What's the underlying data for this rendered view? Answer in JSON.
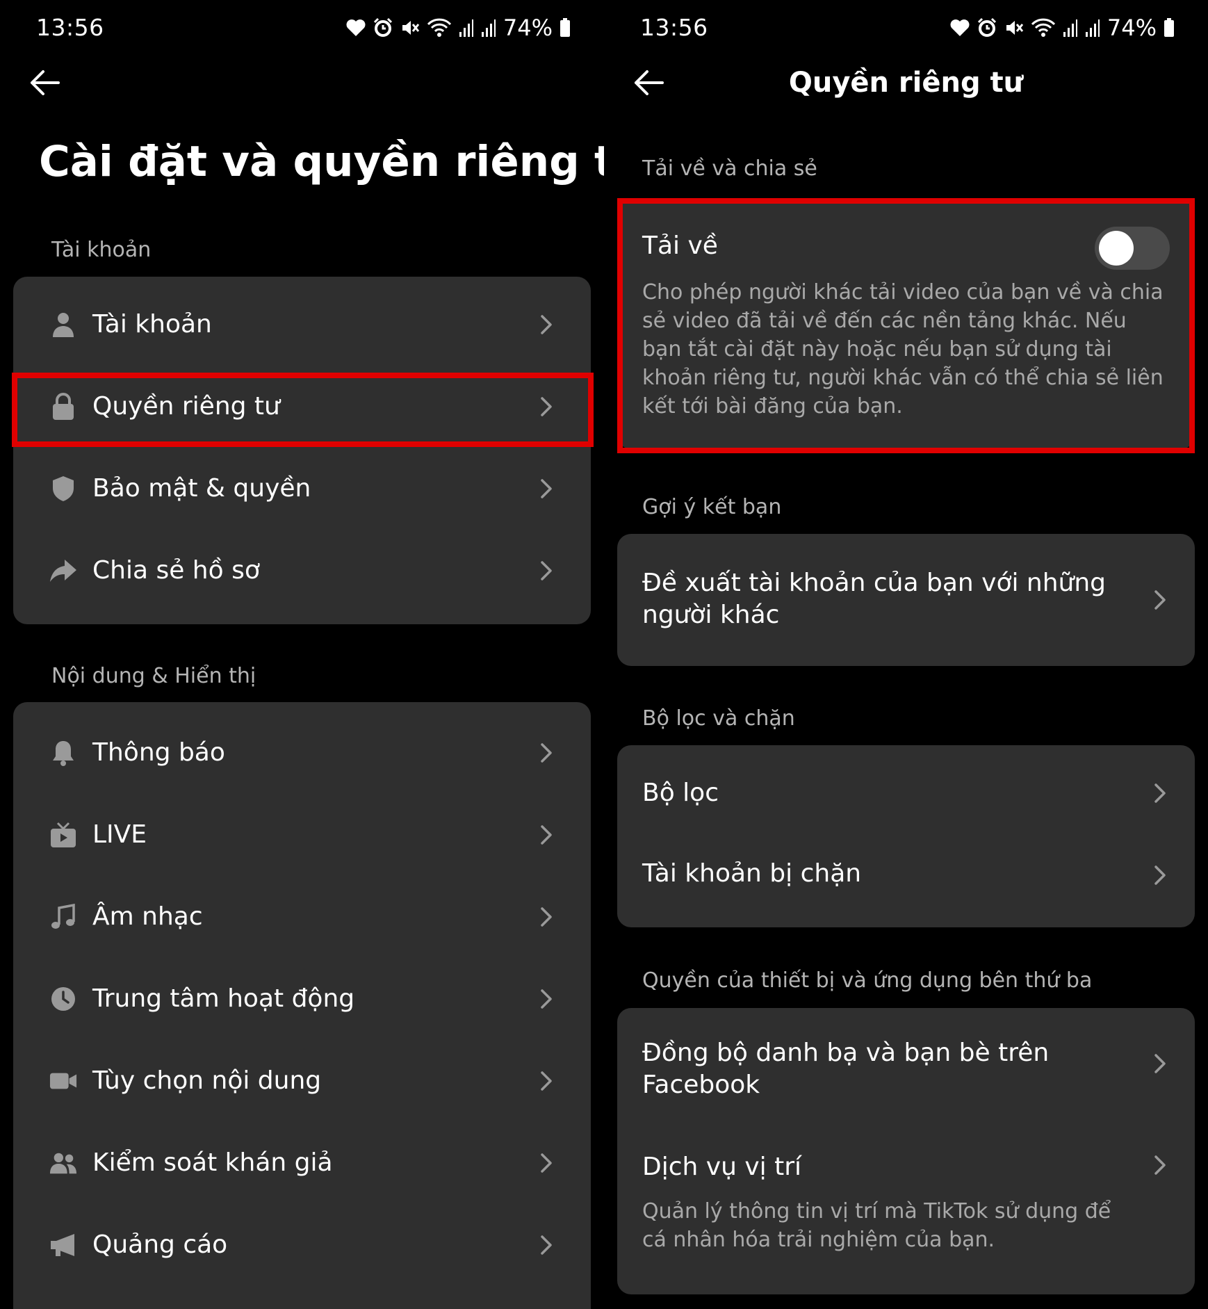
{
  "status_bar": {
    "time": "13:56",
    "battery": "74%",
    "icons": [
      "heart-icon",
      "alarm-icon",
      "mute-icon",
      "wifi-icon",
      "signal-icon",
      "signal-icon",
      "battery-icon"
    ]
  },
  "left": {
    "title": "Cài đặt và quyền riêng tư",
    "section_account": "Tài khoản",
    "account_items": [
      {
        "label": "Tài khoản",
        "icon": "person-icon"
      },
      {
        "label": "Quyền riêng tư",
        "icon": "lock-icon"
      },
      {
        "label": "Bảo mật & quyền",
        "icon": "shield-icon"
      },
      {
        "label": "Chia sẻ hồ sơ",
        "icon": "share-icon"
      }
    ],
    "section_content": "Nội dung & Hiển thị",
    "content_items": [
      {
        "label": "Thông báo",
        "icon": "bell-icon"
      },
      {
        "label": "LIVE",
        "icon": "live-tv-icon"
      },
      {
        "label": "Âm nhạc",
        "icon": "music-note-icon"
      },
      {
        "label": "Trung tâm hoạt động",
        "icon": "clock-icon"
      },
      {
        "label": "Tùy chọn nội dung",
        "icon": "video-camera-icon"
      },
      {
        "label": "Kiểm soát khán giả",
        "icon": "people-icon"
      },
      {
        "label": "Quảng cáo",
        "icon": "megaphone-icon"
      }
    ]
  },
  "right": {
    "title": "Quyền riêng tư",
    "section_download": "Tải về và chia sẻ",
    "download_title": "Tải về",
    "download_desc": "Cho phép người khác tải video của bạn về và chia sẻ video đã tải về đến các nền tảng khác. Nếu bạn tắt cài đặt này hoặc nếu bạn sử dụng tài khoản riêng tư, người khác vẫn có thể chia sẻ liên kết tới bài đăng của bạn.",
    "download_enabled": false,
    "section_suggest": "Gợi ý kết bạn",
    "suggest_item": "Đề xuất tài khoản của bạn với những người khác",
    "section_filter": "Bộ lọc và chặn",
    "filter_items": [
      "Bộ lọc",
      "Tài khoản bị chặn"
    ],
    "section_third": "Quyền của thiết bị và ứng dụng bên thứ ba",
    "sync_item": "Đồng bộ danh bạ và bạn bè trên Facebook",
    "location_title": "Dịch vụ vị trí",
    "location_desc": "Quản lý thông tin vị trí mà TikTok sử dụng để cá nhân hóa trải nghiệm của bạn."
  },
  "colors": {
    "background": "#000000",
    "card": "#2f2f2f",
    "highlight": "#e00000",
    "secondary_text": "#a9a9a9"
  }
}
